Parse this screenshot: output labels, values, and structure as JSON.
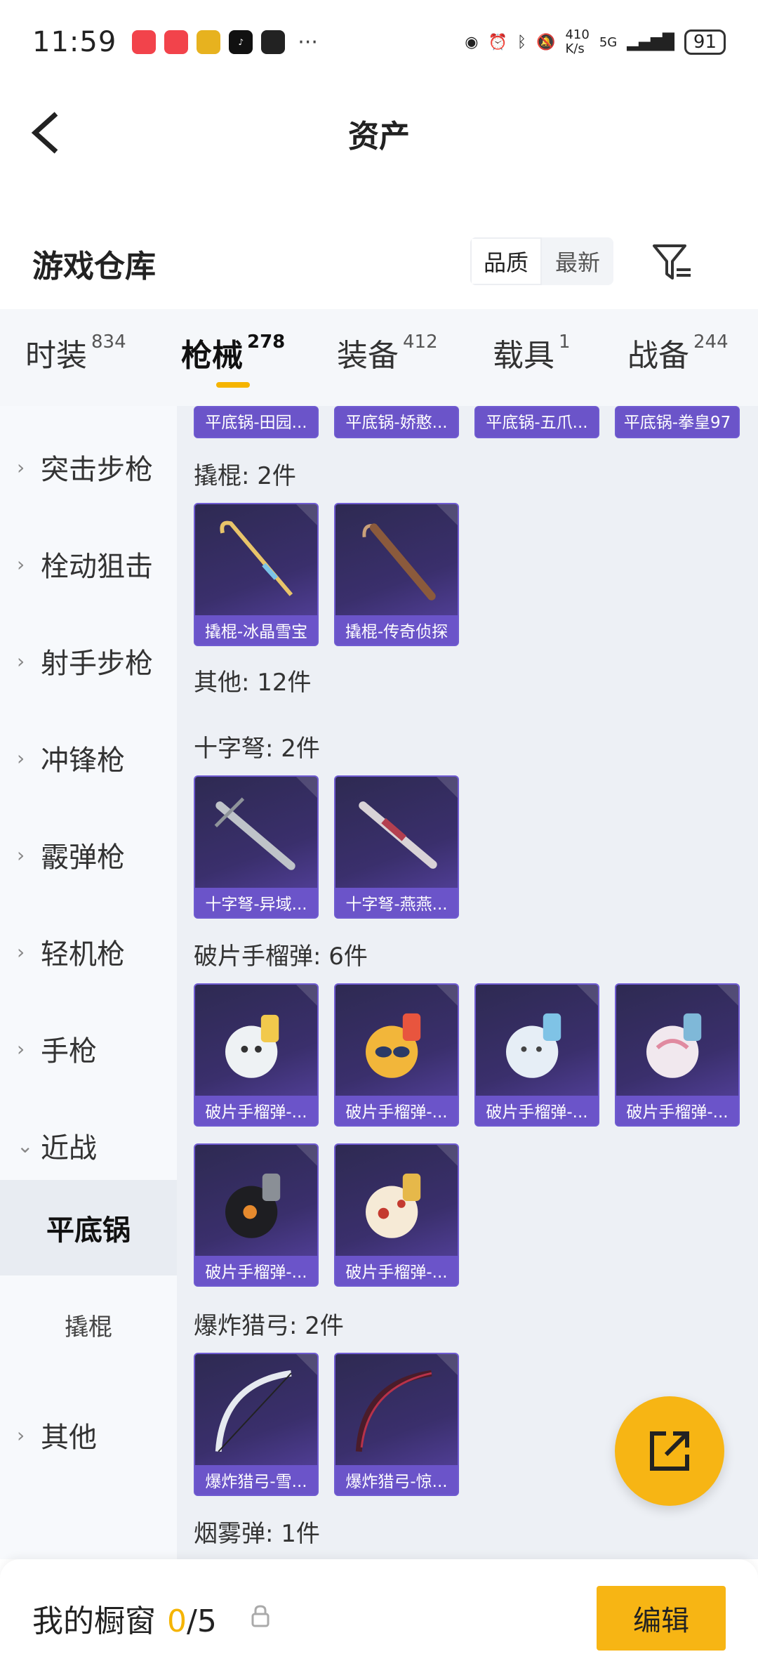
{
  "status_bar": {
    "time": "11:59",
    "network_speed_value": "410",
    "network_speed_unit": "K/s",
    "signal": "5G",
    "battery": "91"
  },
  "header": {
    "title": "资产"
  },
  "warehouse": {
    "title": "游戏仓库",
    "sort_options": [
      "品质",
      "最新"
    ],
    "active_sort": "品质"
  },
  "tabs": [
    {
      "label": "时装",
      "count": "834"
    },
    {
      "label": "枪械",
      "count": "278"
    },
    {
      "label": "装备",
      "count": "412"
    },
    {
      "label": "载具",
      "count": "1"
    },
    {
      "label": "战备",
      "count": "244"
    }
  ],
  "active_tab": "枪械",
  "left_nav": {
    "items": [
      "突击步枪",
      "栓动狙击",
      "射手步枪",
      "冲锋枪",
      "霰弹枪",
      "轻机枪",
      "手枪",
      "近战"
    ],
    "sub_items": [
      "平底锅",
      "撬棍"
    ],
    "active_sub": "平底锅",
    "last_item": "其他"
  },
  "content": {
    "top_row_captions": [
      "平底锅-田园...",
      "平底锅-娇憨...",
      "平底锅-五爪...",
      "平底锅-拳皇97"
    ],
    "crowbar": {
      "title": "撬棍: 2件",
      "items": [
        "撬棍-冰晶雪宝",
        "撬棍-传奇侦探"
      ]
    },
    "other": {
      "title": "其他: 12件"
    },
    "crossbow": {
      "title": "十字弩: 2件",
      "items": [
        "十字弩-异域...",
        "十字弩-燕燕..."
      ]
    },
    "grenade": {
      "title": "破片手榴弹: 6件",
      "items": [
        "破片手榴弹-...",
        "破片手榴弹-...",
        "破片手榴弹-...",
        "破片手榴弹-...",
        "破片手榴弹-...",
        "破片手榴弹-..."
      ]
    },
    "bow": {
      "title": "爆炸猎弓: 2件",
      "items": [
        "爆炸猎弓-雪...",
        "爆炸猎弓-惊..."
      ]
    },
    "smoke": {
      "title": "烟雾弹: 1件"
    }
  },
  "bottom_bar": {
    "label": "我的橱窗",
    "current": "0",
    "total": "/5",
    "edit": "编辑"
  },
  "colors": {
    "accent": "#f5b400",
    "card_caption": "#6b54c9",
    "card_bg": "#3a2f6c"
  }
}
